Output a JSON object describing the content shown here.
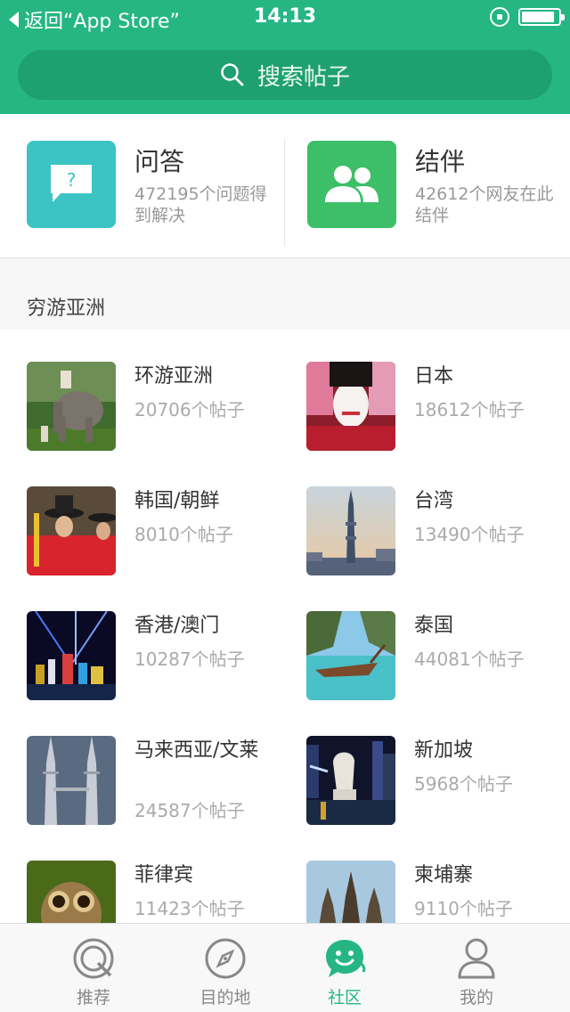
{
  "status_bar": {
    "back_label": "返回“App Store”",
    "time": "14:13"
  },
  "search": {
    "placeholder": "搜索帖子"
  },
  "quick_tiles": [
    {
      "title": "问答",
      "desc": "472195个问题得到解决",
      "icon": "question-bubble-icon",
      "color": "#3cc4c4"
    },
    {
      "title": "结伴",
      "desc": "42612个网友在此结伴",
      "icon": "people-icon",
      "color": "#3cbf68"
    }
  ],
  "section": {
    "title": "穷游亚洲"
  },
  "destinations": [
    {
      "name": "环游亚洲",
      "count": "20706个帖子"
    },
    {
      "name": "日本",
      "count": "18612个帖子"
    },
    {
      "name": "韩国/朝鲜",
      "count": "8010个帖子"
    },
    {
      "name": "台湾",
      "count": "13490个帖子"
    },
    {
      "name": "香港/澳门",
      "count": "10287个帖子"
    },
    {
      "name": "泰国",
      "count": "44081个帖子"
    },
    {
      "name": "马来西亚/文莱",
      "count": "24587个帖子"
    },
    {
      "name": "新加坡",
      "count": "5968个帖子"
    },
    {
      "name": "菲律宾",
      "count": "11423个帖子"
    },
    {
      "name": "柬埔寨",
      "count": "9110个帖子"
    }
  ],
  "tabs": [
    {
      "label": "推荐",
      "icon": "recommend-icon",
      "active": false
    },
    {
      "label": "目的地",
      "icon": "compass-icon",
      "active": false
    },
    {
      "label": "社区",
      "icon": "chat-icon",
      "active": true
    },
    {
      "label": "我的",
      "icon": "user-icon",
      "active": false
    }
  ],
  "colors": {
    "brand_green": "#25b683",
    "search_bg": "#1fa072"
  }
}
